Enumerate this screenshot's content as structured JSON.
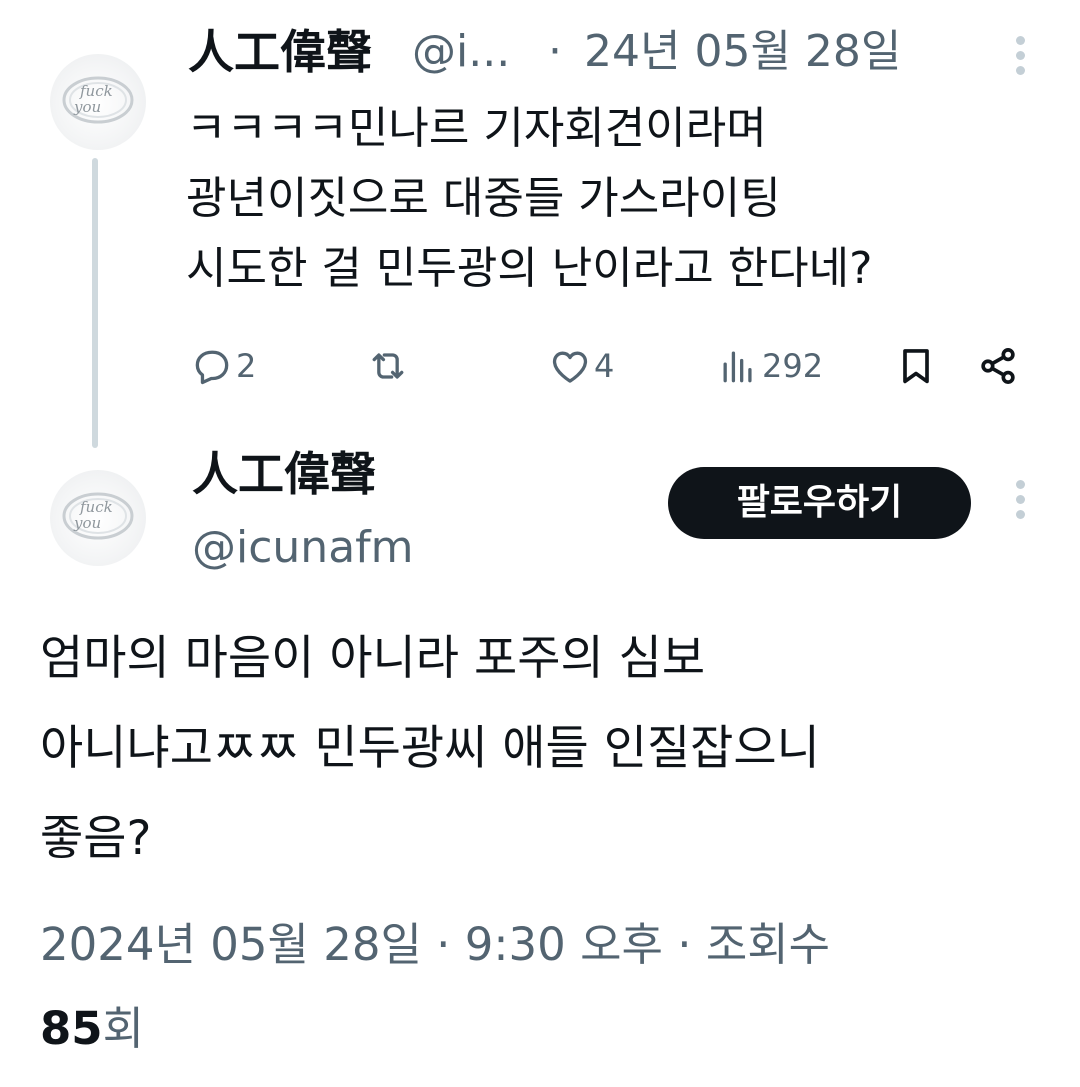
{
  "reply": {
    "author_name": "人工偉聲",
    "handle_truncated": "@i...",
    "separator": "·",
    "date": "24년 05월 28일",
    "text_lines": [
      "ㅋㅋㅋㅋ민나르 기자회견이라며",
      "광년이짓으로 대중들 가스라이팅",
      "시도한 걸 민두광의 난이라고 한다네?"
    ],
    "actions": {
      "replies": "2",
      "likes": "4",
      "views": "292"
    }
  },
  "main": {
    "author_name": "人工偉聲",
    "handle": "@icunafm",
    "follow_label": "팔로우하기",
    "text_lines": [
      "엄마의 마음이 아니라 포주의 심보",
      "아니냐고ㅉㅉ 민두광씨 애들 인질잡으니",
      "좋음?"
    ],
    "timestamp_line": "2024년 05월 28일 · 9:30 오후 · 조회수",
    "views_count": "85",
    "views_suffix": "회"
  },
  "avatar": {
    "logo_text_top": "fuck",
    "logo_text_bottom": "you"
  },
  "icons": {
    "reply": "reply-icon",
    "retweet": "retweet-icon",
    "like": "heart-icon",
    "views": "analytics-icon",
    "bookmark": "bookmark-icon",
    "share": "share-icon",
    "more": "more-icon"
  },
  "colors": {
    "text": "#0f1419",
    "secondary": "#536471",
    "follow_bg": "#0f1419",
    "thread_line": "#cfd9de"
  }
}
